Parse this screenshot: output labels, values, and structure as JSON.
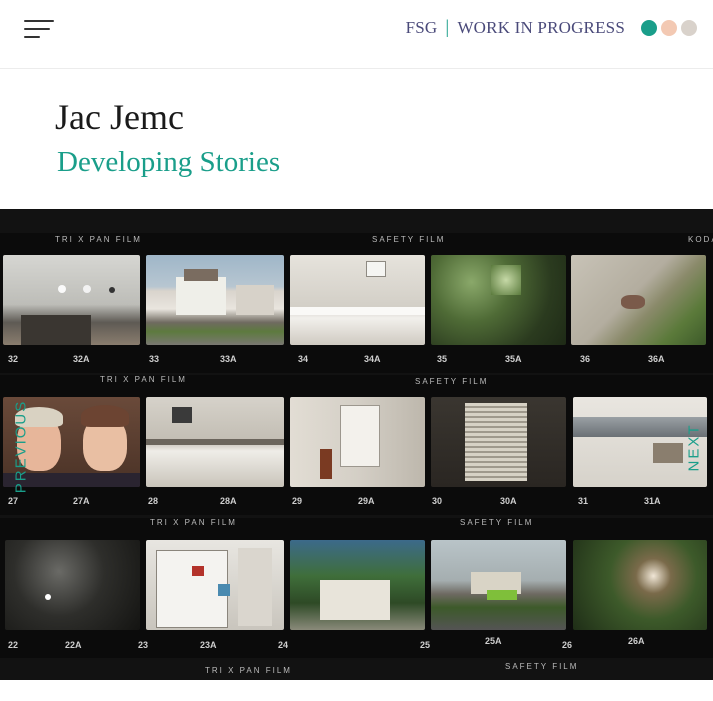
{
  "header": {
    "brand_fsg": "FSG",
    "brand_sep": "|",
    "brand_wip": "WORK IN PROGRESS",
    "dot_colors": [
      "#1a9e8a",
      "#f3c9b3",
      "#d9d2cb"
    ]
  },
  "main": {
    "author": "Jac Jemc",
    "book_title": "Developing Stories"
  },
  "contact_sheet": {
    "strips": [
      {
        "top_labels": [
          "TRI X  PAN FILM",
          "SAFETY  FILM",
          "KODA"
        ],
        "numbers": [
          "32",
          "32A",
          "33",
          "33A",
          "34",
          "34A",
          "35",
          "35A",
          "36",
          "36A"
        ],
        "photos": [
          "door-with-knobs",
          "white-house",
          "bathtub",
          "green-trees",
          "concrete-weeds"
        ]
      },
      {
        "top_labels": [
          "TRI X  PAN FILM",
          "SAFETY  FILM"
        ],
        "numbers": [
          "27",
          "27A",
          "28",
          "28A",
          "29",
          "29A",
          "30",
          "30A",
          "31",
          "31A"
        ],
        "photos": [
          "two-women-portrait",
          "kitchen-counter",
          "empty-room",
          "window-blinds",
          "ceiling-duct"
        ]
      },
      {
        "top_labels": [
          "TRI X  PAN FILM",
          "SAFETY  FILM"
        ],
        "numbers": [
          "22",
          "22A",
          "23",
          "23A",
          "24",
          "25",
          "25A",
          "26",
          "26A"
        ],
        "photos": [
          "night-trees",
          "open-fridge",
          "backyard-table",
          "street-house",
          "foliage-light"
        ]
      }
    ],
    "bottom_label": "TRI X  PAN FILM",
    "bottom_label_2": "SAFETY  FILM",
    "previous_label": "PREVIOUS",
    "next_label": "NEXT"
  }
}
